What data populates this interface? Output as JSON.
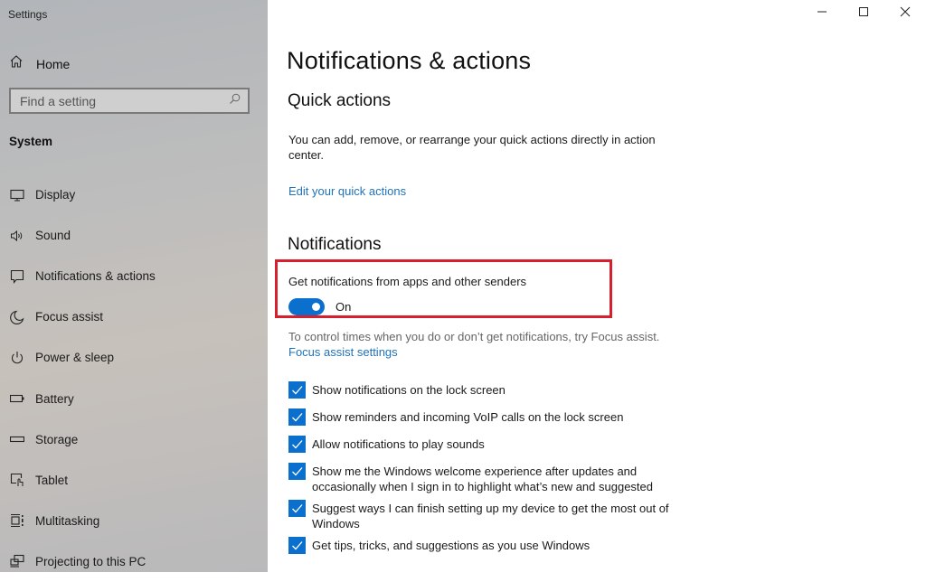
{
  "window": {
    "title": "Settings",
    "controls": {
      "minimize": "minimize-icon",
      "maximize": "maximize-icon",
      "close": "close-icon"
    }
  },
  "sidebar": {
    "home": {
      "label": "Home",
      "icon": "home-icon"
    },
    "search": {
      "placeholder": "Find a setting",
      "value": "",
      "icon": "search-icon"
    },
    "section": "System",
    "items": [
      {
        "label": "Display",
        "icon": "display-icon"
      },
      {
        "label": "Sound",
        "icon": "speaker-icon"
      },
      {
        "label": "Notifications & actions",
        "icon": "notification-icon"
      },
      {
        "label": "Focus assist",
        "icon": "moon-icon"
      },
      {
        "label": "Power & sleep",
        "icon": "power-icon"
      },
      {
        "label": "Battery",
        "icon": "battery-icon"
      },
      {
        "label": "Storage",
        "icon": "storage-icon"
      },
      {
        "label": "Tablet",
        "icon": "tablet-icon"
      },
      {
        "label": "Multitasking",
        "icon": "multitasking-icon"
      },
      {
        "label": "Projecting to this PC",
        "icon": "projecting-icon"
      }
    ]
  },
  "main": {
    "title": "Notifications & actions",
    "quick_actions": {
      "heading": "Quick actions",
      "description": "You can add, remove, or rearrange your quick actions directly in action center.",
      "link": "Edit your quick actions"
    },
    "notifications": {
      "heading": "Notifications",
      "toggle_label": "Get notifications from apps and other senders",
      "toggle_state": "On",
      "toggle_on": true,
      "focus_text": "To control times when you do or don’t get notifications, try Focus assist.",
      "focus_link": "Focus assist settings",
      "checkboxes": [
        {
          "label": "Show notifications on the lock screen",
          "checked": true
        },
        {
          "label": "Show reminders and incoming VoIP calls on the lock screen",
          "checked": true
        },
        {
          "label": "Allow notifications to play sounds",
          "checked": true
        },
        {
          "label": "Show me the Windows welcome experience after updates and occasionally when I sign in to highlight what’s new and suggested",
          "checked": true
        },
        {
          "label": "Suggest ways I can finish setting up my device to get the most out of Windows",
          "checked": true
        },
        {
          "label": "Get tips, tricks, and suggestions as you use Windows",
          "checked": true
        }
      ]
    }
  },
  "colors": {
    "accent": "#0a6fcd",
    "link": "#1f72b8",
    "highlight": "#d6202e"
  }
}
